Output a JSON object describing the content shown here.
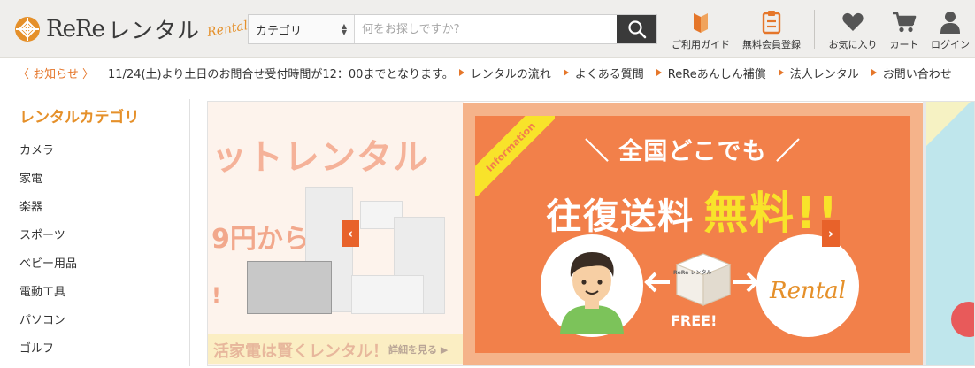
{
  "header": {
    "logo_text": "ReRe",
    "logo_jp": "レンタル",
    "logo_script": "Rental",
    "search": {
      "category_value": "カテゴリ",
      "placeholder": "何をお探しですか?"
    },
    "nav": {
      "guide_label": "ご利用ガイド",
      "register_label": "無料会員登録",
      "favorites_label": "お気に入り",
      "cart_label": "カート",
      "login_label": "ログイン"
    }
  },
  "notice": {
    "label": "〈 お知らせ 〉",
    "text": "11/24(土)より土日のお問合せ受付時間が12：00までとなります。",
    "links": [
      "レンタルの流れ",
      "よくある質問",
      "ReReあんしん補償",
      "法人レンタル",
      "お問い合わせ"
    ]
  },
  "sidebar": {
    "title": "レンタルカテゴリ",
    "items": [
      "カメラ",
      "家電",
      "楽器",
      "スポーツ",
      "ベビー用品",
      "電動工具",
      "パソコン",
      "ゴルフ"
    ]
  },
  "banner": {
    "left": {
      "headline": "ットレンタル",
      "price": "円から!",
      "price_digit": "9",
      "exclaim": "!",
      "footer_text": "活家電は賢くレンタル！",
      "footer_link": "詳細を見る ▶"
    },
    "main": {
      "ribbon": "Information",
      "subtitle": "＼ 全国どこでも ／",
      "title_a": "往復送料",
      "title_b": "無料!!",
      "free_label": "FREE!",
      "box_label": "ReRe レンタル",
      "rental_script": "Rental"
    },
    "prev_label": "‹",
    "next_label": "›"
  },
  "colors": {
    "accent": "#e5902a",
    "notice": "#e5762a",
    "banner_orange": "#f2804a",
    "banner_yellow": "#f8e32a"
  }
}
